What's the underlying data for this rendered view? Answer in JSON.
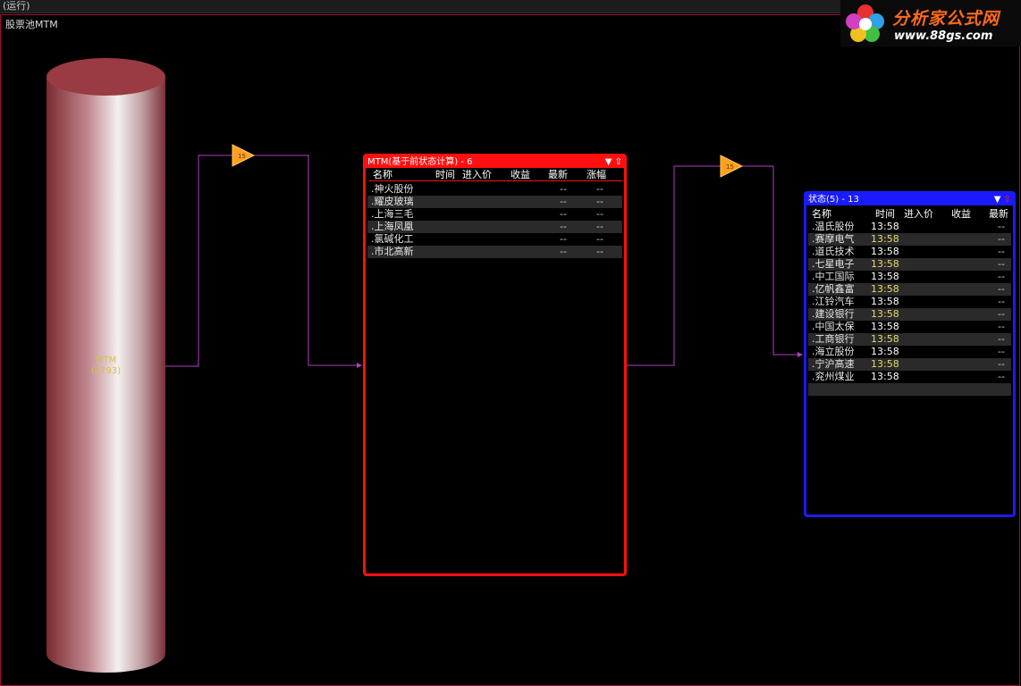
{
  "window": {
    "title": "(运行)"
  },
  "pool": {
    "title": "股票池MTM",
    "cylinder_label": "MTM",
    "cylinder_count": "(2793)"
  },
  "logo": {
    "title": "分析家公式网",
    "url": "www.88gs.com"
  },
  "connector_icons": {
    "name": "filter-triangle-icon",
    "color": "#ffa020"
  },
  "panel1": {
    "title": "MTM(基于前状态计算) - 6",
    "columns": [
      "名称",
      "时间",
      "进入价",
      "收益",
      "最新",
      "涨幅"
    ],
    "rows": [
      {
        "name": ".神火股份",
        "latest": "--",
        "change": "--"
      },
      {
        "name": ".耀皮玻璃",
        "latest": "--",
        "change": "--"
      },
      {
        "name": ".上海三毛",
        "latest": "--",
        "change": "--"
      },
      {
        "name": ".上海凤凰",
        "latest": "--",
        "change": "--"
      },
      {
        "name": ".氯碱化工",
        "latest": "--",
        "change": "--"
      },
      {
        "name": ".市北高新",
        "latest": "--",
        "change": "--"
      }
    ],
    "color": "#ff1010"
  },
  "panel2": {
    "title": "状态(5) - 13",
    "columns": [
      "名称",
      "时间",
      "进入价",
      "收益",
      "最新"
    ],
    "rows": [
      {
        "name": ".温氏股份",
        "time": "13:58",
        "latest": "--"
      },
      {
        "name": ".赛摩电气",
        "time": "13:58",
        "latest": "--"
      },
      {
        "name": ".道氏技术",
        "time": "13:58",
        "latest": "--"
      },
      {
        "name": ".七星电子",
        "time": "13:58",
        "latest": "--"
      },
      {
        "name": ".中工国际",
        "time": "13:58",
        "latest": "--"
      },
      {
        "name": ".亿帆鑫富",
        "time": "13:58",
        "latest": "--"
      },
      {
        "name": ".江铃汽车",
        "time": "13:58",
        "latest": "--"
      },
      {
        "name": ".建设银行",
        "time": "13:58",
        "latest": "--"
      },
      {
        "name": ".中国太保",
        "time": "13:58",
        "latest": "--"
      },
      {
        "name": ".工商银行",
        "time": "13:58",
        "latest": "--"
      },
      {
        "name": ".海立股份",
        "time": "13:58",
        "latest": "--"
      },
      {
        "name": ".宁沪高速",
        "time": "13:58",
        "latest": "--"
      },
      {
        "name": ".兖州煤业",
        "time": "13:58",
        "latest": "--"
      }
    ],
    "color": "#1a1aff"
  },
  "colors": {
    "connector": "#b040c0",
    "time_highlight": "#e8d870"
  }
}
